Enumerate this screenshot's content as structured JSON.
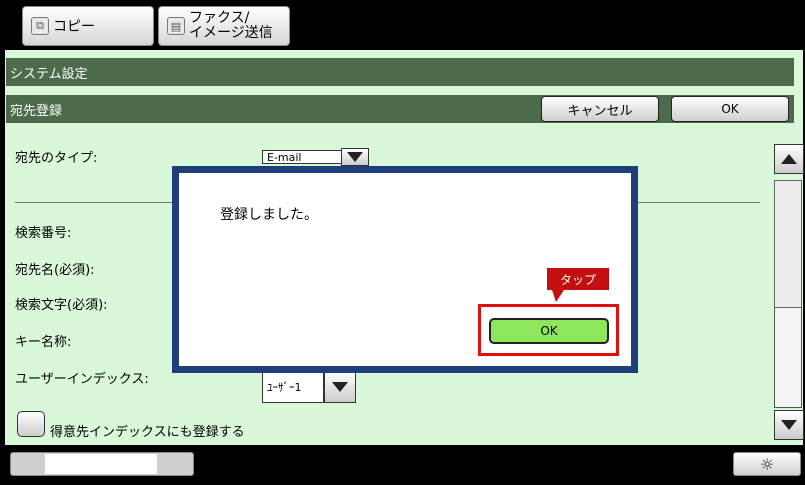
{
  "tabs": {
    "copy": "コピー",
    "fax_line1": "ファクス/",
    "fax_line2": "イメージ送信"
  },
  "header": {
    "system_settings": "システム設定",
    "page_title": "宛先登録",
    "cancel_label": "キャンセル",
    "ok_label": "OK"
  },
  "form": {
    "dest_type_label": "宛先のタイプ:",
    "dest_type_value": "E-mail",
    "search_no_label": "検索番号:",
    "dest_name_label": "宛先名(必須):",
    "search_text_label": "検索文字(必須):",
    "key_name_label": "キー名称:",
    "user_index_label": "ユーザーインデックス:",
    "user_index_value": "ﾕｰｻﾞｰ1",
    "frequent_label": "得意先インデックスにも登録する"
  },
  "dialog": {
    "message": "登録しました。",
    "ok_label": "OK",
    "callout": "タップ"
  },
  "progress": {
    "fraction": 0.61
  },
  "colors": {
    "panel_bg": "#d9f7d9",
    "bar_bg": "#4b6b4b",
    "dialog_border": "#1f3f7a",
    "ok_green": "#8ee65a",
    "highlight_red": "#e01010"
  }
}
